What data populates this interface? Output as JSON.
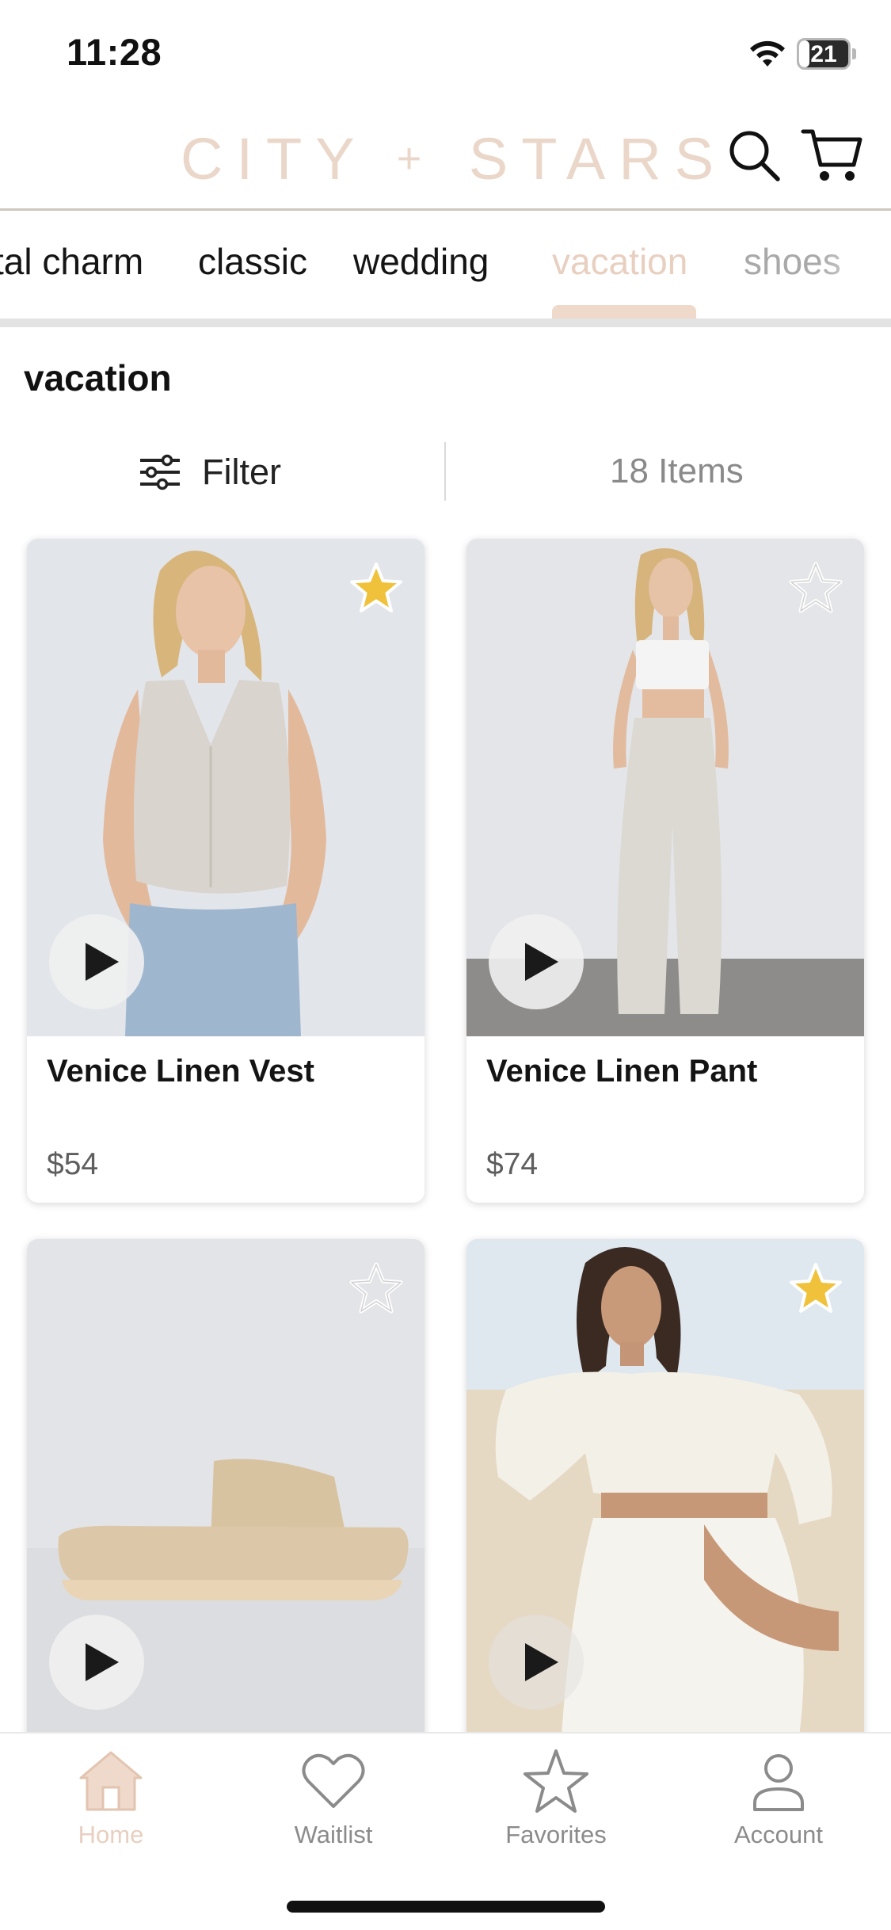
{
  "status_bar": {
    "time": "11:28",
    "battery_level": "21",
    "battery_fraction": 0.21
  },
  "header": {
    "logo_left": "CITY",
    "logo_plus": "+",
    "logo_right": "STARS",
    "search_icon": "search-icon",
    "cart_icon": "cart-icon",
    "brand_color": "#ead7c9"
  },
  "categories": [
    {
      "label": "tal charm"
    },
    {
      "label": "classic"
    },
    {
      "label": "wedding"
    },
    {
      "label": "vacation",
      "active": true
    },
    {
      "label": "shoes"
    }
  ],
  "page": {
    "title": "vacation"
  },
  "toolbar": {
    "filter_label": "Filter",
    "filter_icon": "sliders-icon",
    "items_count": "18 Items"
  },
  "products": [
    {
      "name": "Venice Linen Vest",
      "price": "$54",
      "favorited": true,
      "image": "woman in linen vest and jeans"
    },
    {
      "name": "Venice Linen Pant",
      "price": "$74",
      "favorited": false,
      "image": "woman in white crop top and linen pants"
    },
    {
      "name": "",
      "price": "",
      "favorited": false,
      "image": "woven platform sandal"
    },
    {
      "name": "",
      "price": "",
      "favorited": true,
      "image": "woman in white off-shoulder set on beach"
    }
  ],
  "bottom_nav": [
    {
      "label": "Home",
      "icon": "home-icon",
      "active": true
    },
    {
      "label": "Waitlist",
      "icon": "heart-icon",
      "active": false
    },
    {
      "label": "Favorites",
      "icon": "star-icon",
      "active": false
    },
    {
      "label": "Account",
      "icon": "person-icon",
      "active": false
    }
  ],
  "colors": {
    "accent": "#e8cfc0",
    "favorite_star": "#f0c23c",
    "text": "#111111",
    "muted": "#8b8b8b"
  }
}
